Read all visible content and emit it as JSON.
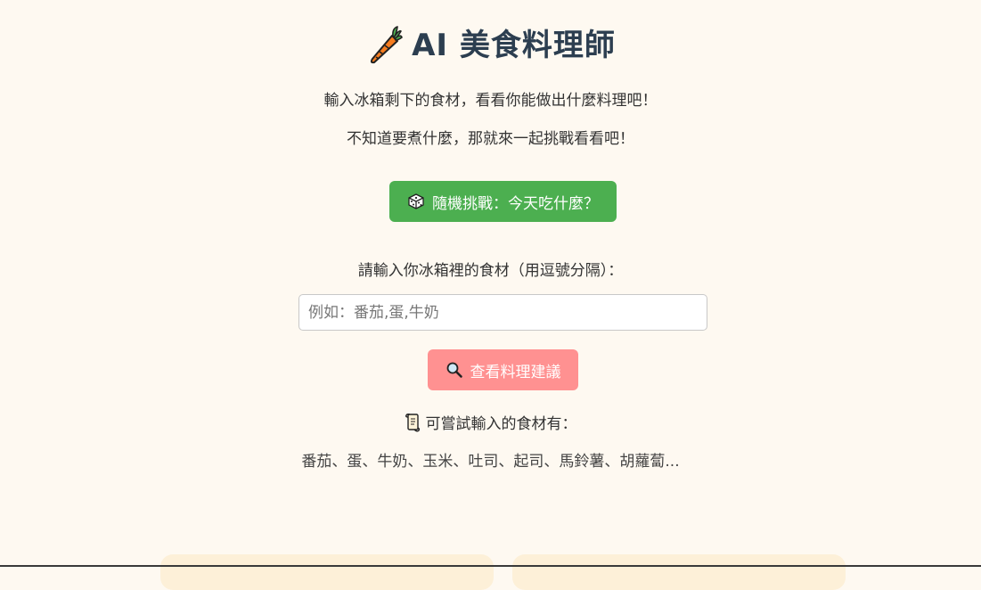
{
  "header": {
    "icon": "carrot-icon",
    "title": "AI 美食料理師"
  },
  "intro": {
    "line1": "輸入冰箱剩下的食材，看看你能做出什麼料理吧！",
    "line2": "不知道要煮什麼，那就來一起挑戰看看吧！"
  },
  "random_button": {
    "icon": "dice-icon",
    "label": "隨機挑戰：今天吃什麼？",
    "color": "#4caf50"
  },
  "ingredient_form": {
    "prompt": "請輸入你冰箱裡的食材（用逗號分隔）：",
    "placeholder": "例如：番茄,蛋,牛奶",
    "value": ""
  },
  "suggest_button": {
    "icon": "magnifier-icon",
    "label": "查看料理建議",
    "color": "#ff9191"
  },
  "hint": {
    "icon": "scroll-icon",
    "label": "可嘗試輸入的食材有：",
    "list": "番茄、蛋、牛奶、玉米、吐司、起司、馬鈴薯、胡蘿蔔..."
  },
  "colors": {
    "background": "#fef9f1",
    "title": "#2c3e50",
    "card": "#fdf0d8"
  }
}
